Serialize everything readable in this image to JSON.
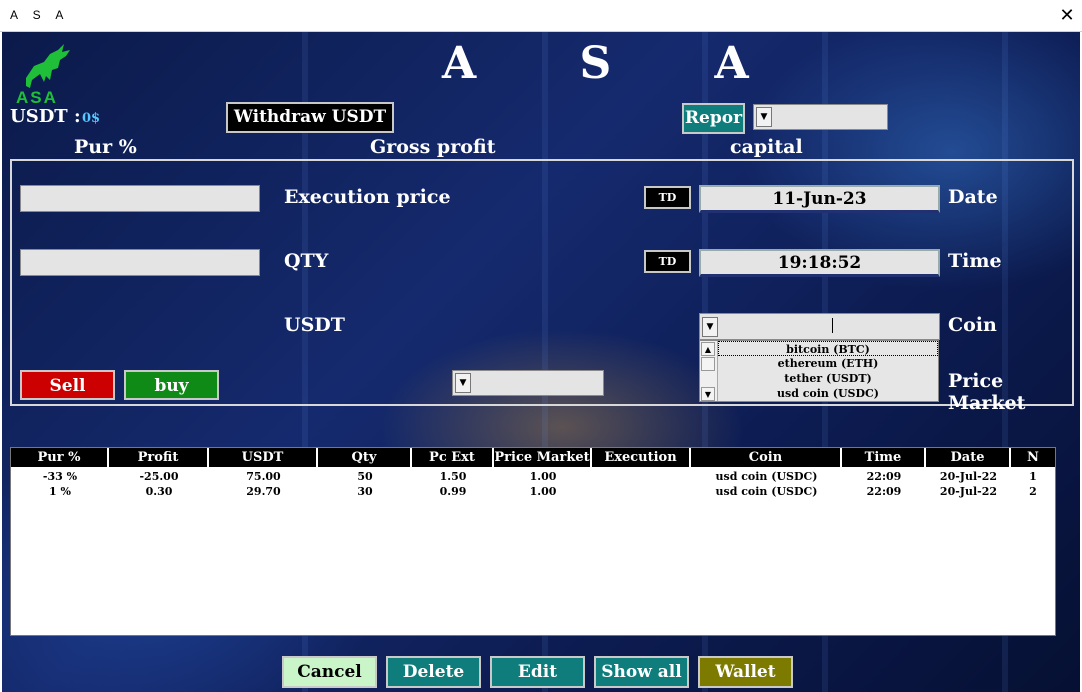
{
  "window": {
    "title": "A S A",
    "close_glyph": "✕"
  },
  "header": {
    "title": "A S A",
    "logo_text": "ASA",
    "logo_icon": "bull-icon"
  },
  "balance": {
    "label": "USDT :",
    "value": "0$"
  },
  "toolbar": {
    "withdraw_label": "Withdraw USDT",
    "report_label": "Repor",
    "report_dropdown_value": ""
  },
  "summary_headers": {
    "pur": "Pur %",
    "gross": "Gross profit",
    "capital": "capital"
  },
  "form": {
    "execution_price_label": "Execution price",
    "execution_price_value": "",
    "qty_label": "QTY",
    "qty_value": "",
    "usdt_label": "USDT",
    "td_label": "TD",
    "date_label": "Date",
    "date_value": "11-Jun-23",
    "time_label": "Time",
    "time_value": "19:18:52",
    "coin_label": "Coin",
    "coin_value": "",
    "coin_options": [
      "bitcoin (BTC)",
      "ethereum (ETH)",
      "tether (USDT)",
      "usd coin (USDC)"
    ],
    "price_market_label": "Price Market",
    "price_market_value": "",
    "sell_label": "Sell",
    "buy_label": "buy"
  },
  "table": {
    "columns": [
      "Pur %",
      "Profit",
      "USDT",
      "Qty",
      "Pc Ext",
      "Price Market",
      "Execution",
      "Coin",
      "Time",
      "Date",
      "N"
    ],
    "rows": [
      [
        "-33 %",
        "-25.00",
        "75.00",
        "50",
        "1.50",
        "1.00",
        "",
        "usd coin (USDC)",
        "22:09",
        "20-Jul-22",
        "1"
      ],
      [
        "1 %",
        "0.30",
        "29.70",
        "30",
        "0.99",
        "1.00",
        "",
        "usd coin (USDC)",
        "22:09",
        "20-Jul-22",
        "2"
      ]
    ]
  },
  "actions": {
    "cancel": "Cancel",
    "delete": "Delete",
    "edit": "Edit",
    "show_all": "Show all",
    "wallet": "Wallet"
  },
  "colors": {
    "sell": "#cc0000",
    "buy": "#0f8a16",
    "teal": "#0f7d7b",
    "cancel": "#c9f5c9",
    "wallet": "#7d7a00",
    "logo": "#1fbf3a",
    "usdt_value": "#56c8ff"
  }
}
